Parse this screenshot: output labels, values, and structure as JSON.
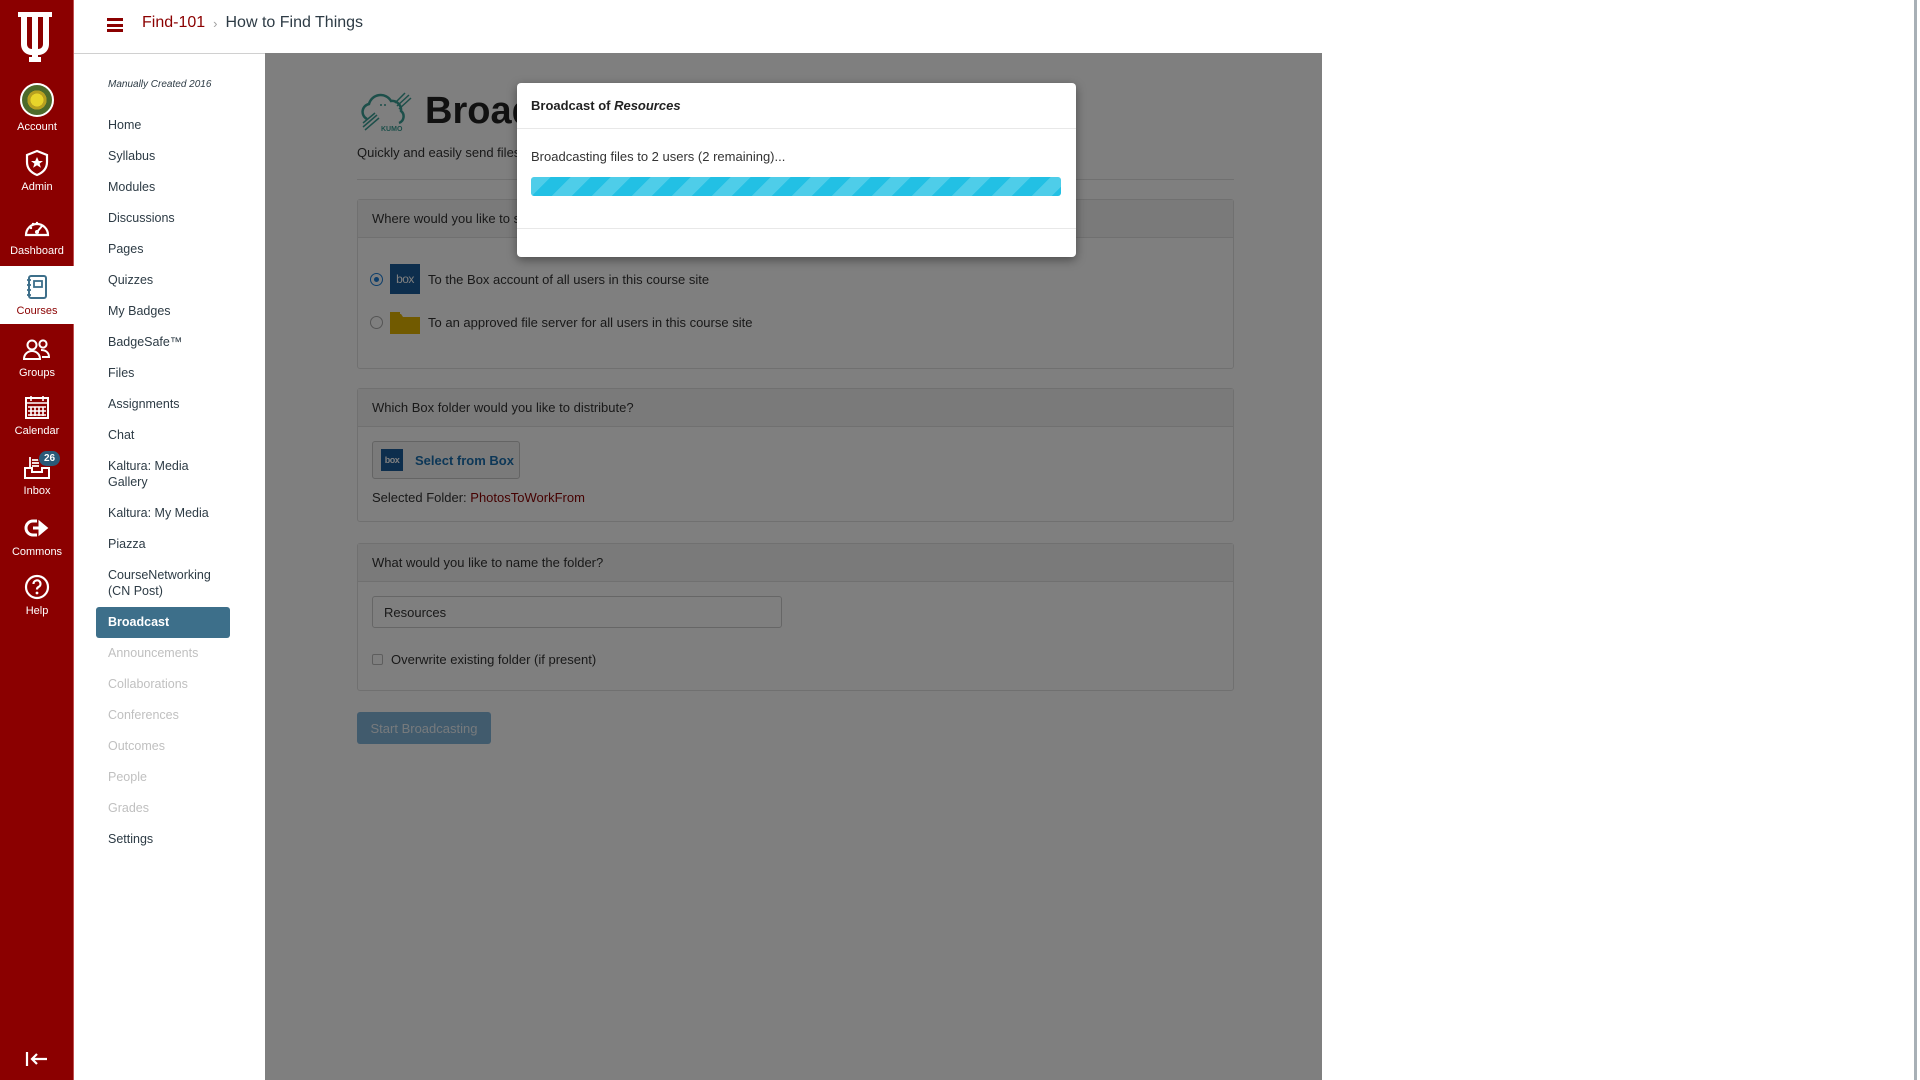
{
  "global_nav": {
    "items": [
      {
        "label": "Account",
        "icon": "avatar-icon"
      },
      {
        "label": "Admin",
        "icon": "shield-star-icon"
      },
      {
        "label": "Dashboard",
        "icon": "speedometer-icon"
      },
      {
        "label": "Courses",
        "icon": "notebook-icon",
        "active": true
      },
      {
        "label": "Groups",
        "icon": "users-icon"
      },
      {
        "label": "Calendar",
        "icon": "calendar-icon"
      },
      {
        "label": "Inbox",
        "icon": "inbox-icon",
        "badge": "26"
      },
      {
        "label": "Commons",
        "icon": "commons-icon"
      },
      {
        "label": "Help",
        "icon": "help-icon"
      }
    ],
    "collapse_icon": "collapse-arrow-icon"
  },
  "header": {
    "breadcrumb": {
      "course": "Find-101",
      "separator": "›",
      "current": "How to Find Things"
    }
  },
  "course_nav": {
    "term": "Manually Created 2016",
    "items": [
      {
        "label": "Home",
        "state": "normal"
      },
      {
        "label": "Syllabus",
        "state": "normal"
      },
      {
        "label": "Modules",
        "state": "normal"
      },
      {
        "label": "Discussions",
        "state": "normal"
      },
      {
        "label": "Pages",
        "state": "normal"
      },
      {
        "label": "Quizzes",
        "state": "normal"
      },
      {
        "label": "My Badges",
        "state": "normal"
      },
      {
        "label": "BadgeSafe™",
        "state": "normal"
      },
      {
        "label": "Files",
        "state": "normal"
      },
      {
        "label": "Assignments",
        "state": "normal"
      },
      {
        "label": "Chat",
        "state": "normal"
      },
      {
        "label": "Kaltura: Media Gallery",
        "state": "normal"
      },
      {
        "label": "Kaltura: My Media",
        "state": "normal"
      },
      {
        "label": "Piazza",
        "state": "normal"
      },
      {
        "label": "CourseNetworking (CN Post)",
        "state": "normal"
      },
      {
        "label": "Broadcast",
        "state": "active"
      },
      {
        "label": "Announcements",
        "state": "disabled"
      },
      {
        "label": "Collaborations",
        "state": "disabled"
      },
      {
        "label": "Conferences",
        "state": "disabled"
      },
      {
        "label": "Outcomes",
        "state": "disabled"
      },
      {
        "label": "People",
        "state": "disabled"
      },
      {
        "label": "Grades",
        "state": "disabled"
      },
      {
        "label": "Settings",
        "state": "normal"
      }
    ]
  },
  "main": {
    "logo_text": "KUMO",
    "title": "Broadcast",
    "subtitle": "Quickly and easily send files",
    "destination": {
      "question": "Where would you like to send the files?",
      "options": [
        {
          "label": "To the Box account of all users in this course site",
          "icon": "box-logo-icon",
          "icon_text": "box",
          "selected": true
        },
        {
          "label": "To an approved file server for all users in this course site",
          "icon": "folder-icon",
          "selected": false
        }
      ]
    },
    "folder": {
      "question": "Which Box folder would you like to distribute?",
      "button_label": "Select from Box",
      "button_icon_text": "box",
      "selected_label": "Selected Folder: ",
      "selected_value": "PhotosToWorkFrom"
    },
    "name": {
      "question": "What would you like to name the folder?",
      "value": "Resources",
      "overwrite_label": "Overwrite existing folder (if present)",
      "overwrite_checked": false
    },
    "start_button": "Start Broadcasting"
  },
  "modal": {
    "title_prefix": "Broadcast of ",
    "title_emph": "Resources",
    "message": "Broadcasting files to 2 users (2 remaining)...",
    "progress_percent": 100,
    "progress_color": "#22c0e4"
  },
  "colors": {
    "brand": "#8b0000",
    "active_nav": "#3d6f8a",
    "link": "#1b6fae"
  }
}
